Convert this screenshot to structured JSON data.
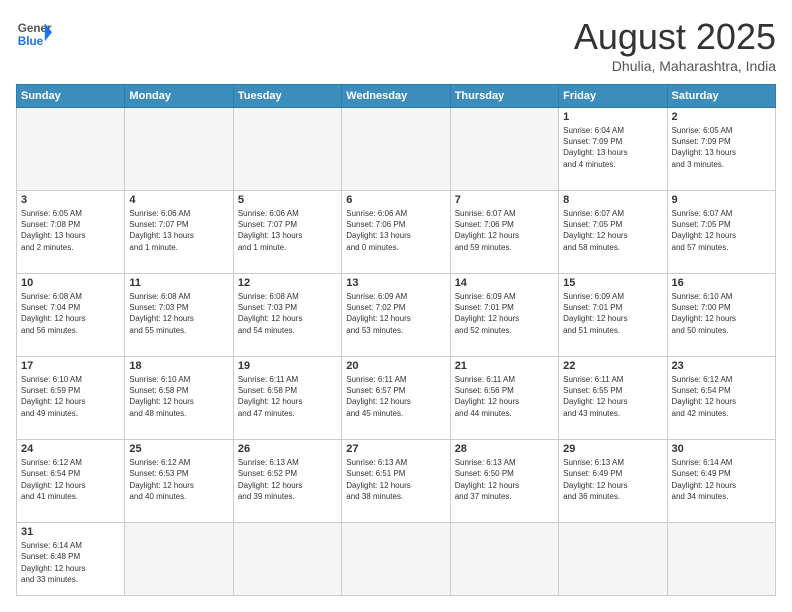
{
  "logo": {
    "general": "General",
    "blue": "Blue"
  },
  "title": "August 2025",
  "subtitle": "Dhulia, Maharashtra, India",
  "days_header": [
    "Sunday",
    "Monday",
    "Tuesday",
    "Wednesday",
    "Thursday",
    "Friday",
    "Saturday"
  ],
  "weeks": [
    [
      {
        "day": "",
        "info": ""
      },
      {
        "day": "",
        "info": ""
      },
      {
        "day": "",
        "info": ""
      },
      {
        "day": "",
        "info": ""
      },
      {
        "day": "",
        "info": ""
      },
      {
        "day": "1",
        "info": "Sunrise: 6:04 AM\nSunset: 7:09 PM\nDaylight: 13 hours\nand 4 minutes."
      },
      {
        "day": "2",
        "info": "Sunrise: 6:05 AM\nSunset: 7:09 PM\nDaylight: 13 hours\nand 3 minutes."
      }
    ],
    [
      {
        "day": "3",
        "info": "Sunrise: 6:05 AM\nSunset: 7:08 PM\nDaylight: 13 hours\nand 2 minutes."
      },
      {
        "day": "4",
        "info": "Sunrise: 6:06 AM\nSunset: 7:07 PM\nDaylight: 13 hours\nand 1 minute."
      },
      {
        "day": "5",
        "info": "Sunrise: 6:06 AM\nSunset: 7:07 PM\nDaylight: 13 hours\nand 1 minute."
      },
      {
        "day": "6",
        "info": "Sunrise: 6:06 AM\nSunset: 7:06 PM\nDaylight: 13 hours\nand 0 minutes."
      },
      {
        "day": "7",
        "info": "Sunrise: 6:07 AM\nSunset: 7:06 PM\nDaylight: 12 hours\nand 59 minutes."
      },
      {
        "day": "8",
        "info": "Sunrise: 6:07 AM\nSunset: 7:05 PM\nDaylight: 12 hours\nand 58 minutes."
      },
      {
        "day": "9",
        "info": "Sunrise: 6:07 AM\nSunset: 7:05 PM\nDaylight: 12 hours\nand 57 minutes."
      }
    ],
    [
      {
        "day": "10",
        "info": "Sunrise: 6:08 AM\nSunset: 7:04 PM\nDaylight: 12 hours\nand 56 minutes."
      },
      {
        "day": "11",
        "info": "Sunrise: 6:08 AM\nSunset: 7:03 PM\nDaylight: 12 hours\nand 55 minutes."
      },
      {
        "day": "12",
        "info": "Sunrise: 6:08 AM\nSunset: 7:03 PM\nDaylight: 12 hours\nand 54 minutes."
      },
      {
        "day": "13",
        "info": "Sunrise: 6:09 AM\nSunset: 7:02 PM\nDaylight: 12 hours\nand 53 minutes."
      },
      {
        "day": "14",
        "info": "Sunrise: 6:09 AM\nSunset: 7:01 PM\nDaylight: 12 hours\nand 52 minutes."
      },
      {
        "day": "15",
        "info": "Sunrise: 6:09 AM\nSunset: 7:01 PM\nDaylight: 12 hours\nand 51 minutes."
      },
      {
        "day": "16",
        "info": "Sunrise: 6:10 AM\nSunset: 7:00 PM\nDaylight: 12 hours\nand 50 minutes."
      }
    ],
    [
      {
        "day": "17",
        "info": "Sunrise: 6:10 AM\nSunset: 6:59 PM\nDaylight: 12 hours\nand 49 minutes."
      },
      {
        "day": "18",
        "info": "Sunrise: 6:10 AM\nSunset: 6:58 PM\nDaylight: 12 hours\nand 48 minutes."
      },
      {
        "day": "19",
        "info": "Sunrise: 6:11 AM\nSunset: 6:58 PM\nDaylight: 12 hours\nand 47 minutes."
      },
      {
        "day": "20",
        "info": "Sunrise: 6:11 AM\nSunset: 6:57 PM\nDaylight: 12 hours\nand 45 minutes."
      },
      {
        "day": "21",
        "info": "Sunrise: 6:11 AM\nSunset: 6:56 PM\nDaylight: 12 hours\nand 44 minutes."
      },
      {
        "day": "22",
        "info": "Sunrise: 6:11 AM\nSunset: 6:55 PM\nDaylight: 12 hours\nand 43 minutes."
      },
      {
        "day": "23",
        "info": "Sunrise: 6:12 AM\nSunset: 6:54 PM\nDaylight: 12 hours\nand 42 minutes."
      }
    ],
    [
      {
        "day": "24",
        "info": "Sunrise: 6:12 AM\nSunset: 6:54 PM\nDaylight: 12 hours\nand 41 minutes."
      },
      {
        "day": "25",
        "info": "Sunrise: 6:12 AM\nSunset: 6:53 PM\nDaylight: 12 hours\nand 40 minutes."
      },
      {
        "day": "26",
        "info": "Sunrise: 6:13 AM\nSunset: 6:52 PM\nDaylight: 12 hours\nand 39 minutes."
      },
      {
        "day": "27",
        "info": "Sunrise: 6:13 AM\nSunset: 6:51 PM\nDaylight: 12 hours\nand 38 minutes."
      },
      {
        "day": "28",
        "info": "Sunrise: 6:13 AM\nSunset: 6:50 PM\nDaylight: 12 hours\nand 37 minutes."
      },
      {
        "day": "29",
        "info": "Sunrise: 6:13 AM\nSunset: 6:49 PM\nDaylight: 12 hours\nand 36 minutes."
      },
      {
        "day": "30",
        "info": "Sunrise: 6:14 AM\nSunset: 6:49 PM\nDaylight: 12 hours\nand 34 minutes."
      }
    ],
    [
      {
        "day": "31",
        "info": "Sunrise: 6:14 AM\nSunset: 6:48 PM\nDaylight: 12 hours\nand 33 minutes."
      },
      {
        "day": "",
        "info": ""
      },
      {
        "day": "",
        "info": ""
      },
      {
        "day": "",
        "info": ""
      },
      {
        "day": "",
        "info": ""
      },
      {
        "day": "",
        "info": ""
      },
      {
        "day": "",
        "info": ""
      }
    ]
  ]
}
